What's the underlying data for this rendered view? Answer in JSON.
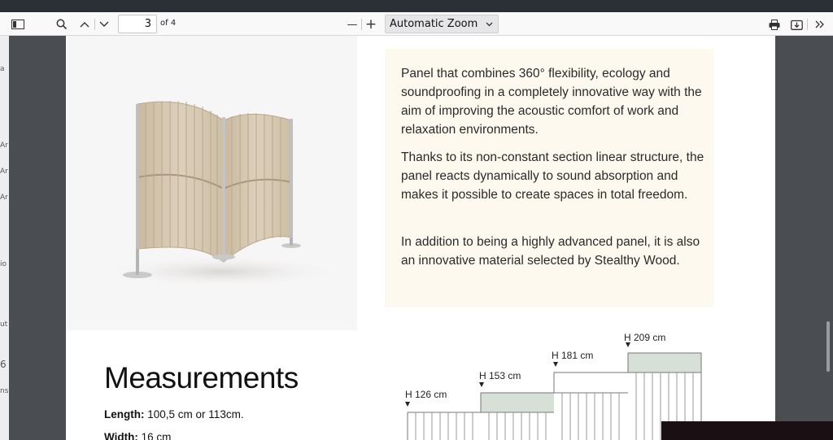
{
  "toolbar": {
    "page_number": "3",
    "page_of": "of 4",
    "zoom_minus": "—",
    "zoom_plus": "+",
    "zoom_label": "Automatic Zoom"
  },
  "left_panel_fragments": [
    "a",
    "Ar",
    "Ar",
    "Ar",
    "io",
    "ut",
    "6",
    "ns"
  ],
  "content": {
    "paragraphs": [
      "Panel that combines 360° flexibility, ecology and soundproofing in a completely innovative way with the aim of improving the acoustic comfort of work and relaxation environments.",
      "Thanks to its non-constant section linear structure, the panel reacts dynamically to sound absorption and makes it possible to create spaces in total freedom.",
      "In addition to being a highly advanced panel, it is also an innovative material selected by Stealthy Wood."
    ],
    "measurements_title": "Measurements",
    "length_label": "Length:",
    "length_value": "100,5 cm or 113cm.",
    "width_label": "Width:",
    "width_value": "16 cm"
  },
  "diagram": {
    "heights": [
      "H 126 cm",
      "H 153 cm",
      "H 181 cm",
      "H 209 cm"
    ]
  },
  "colors": {
    "panel_fabric": "#d6c9b4",
    "text_bg": "#fdf9ef",
    "diagram_fill": "#d7e0d6"
  }
}
